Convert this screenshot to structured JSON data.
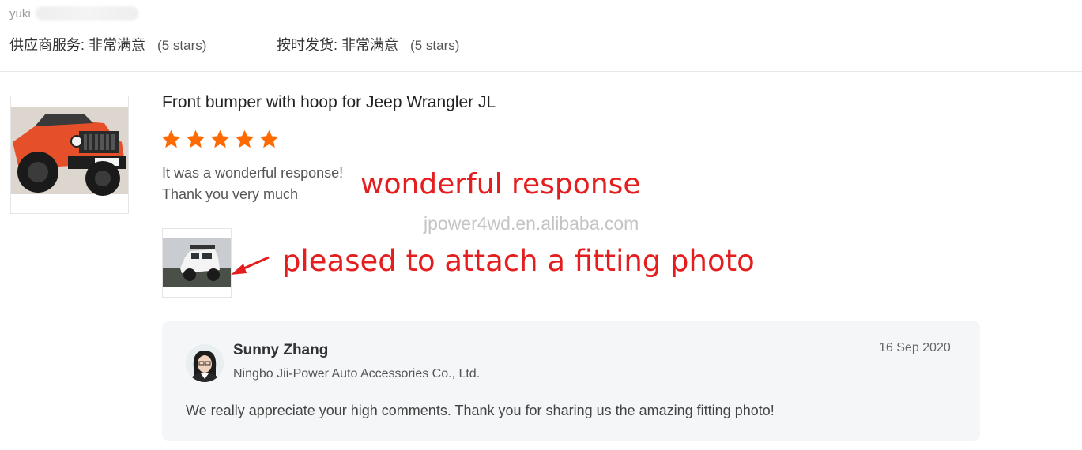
{
  "reviewer": {
    "name": "yuki"
  },
  "ratings": [
    {
      "label": "供应商服务:",
      "value": "非常满意",
      "stars_note": "(5 stars)"
    },
    {
      "label": "按时发货:",
      "value": "非常满意",
      "stars_note": "(5 stars)"
    }
  ],
  "review": {
    "product_title": "Front bumper with hoop for Jeep Wrangler JL",
    "stars": 5,
    "text_line1": "It was a wonderful response!",
    "text_line2": "Thank you very much"
  },
  "annotations": {
    "wonderful": "wonderful response",
    "photo": "pleased to attach a fitting photo"
  },
  "watermark": "jpower4wd.en.alibaba.com",
  "reply": {
    "name": "Sunny Zhang",
    "company": "Ningbo Jii-Power Auto Accessories Co., Ltd.",
    "date": "16 Sep 2020",
    "text": "We really appreciate your high comments. Thank you for sharing us the amazing fitting photo!"
  },
  "colors": {
    "star": "#ff6a00",
    "annotation": "#e41e1e",
    "reply_bg": "#f5f6f8"
  }
}
